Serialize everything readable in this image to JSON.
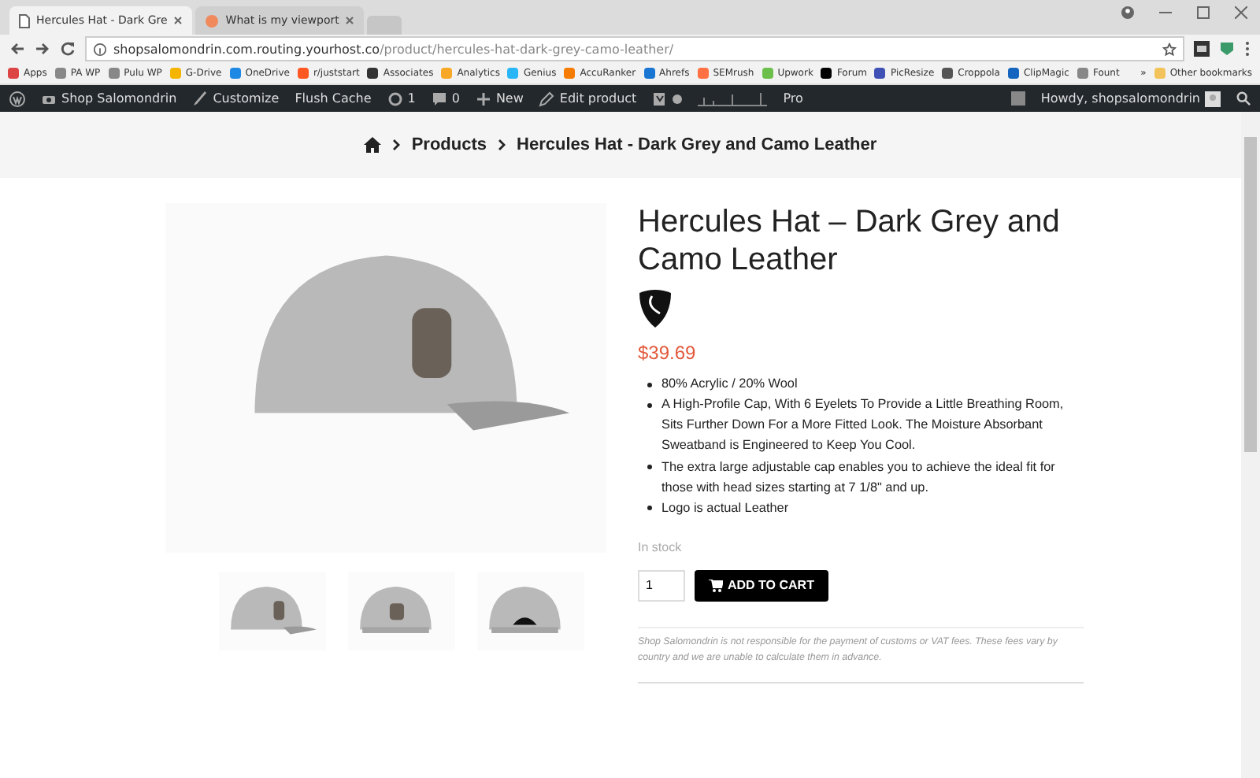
{
  "browser": {
    "tabs": [
      {
        "title": "Hercules Hat - Dark Gre",
        "selected": true
      },
      {
        "title": "What is my viewport",
        "selected": false
      }
    ],
    "url": {
      "host": "shopsalomondrin.com.routing.yourhost.co",
      "path": "/product/hercules-hat-dark-grey-camo-leather/"
    },
    "bookmarks": [
      "Apps",
      "PA WP",
      "Pulu WP",
      "G-Drive",
      "OneDrive",
      "r/juststart",
      "Associates",
      "Analytics",
      "Genius",
      "AccuRanker",
      "Ahrefs",
      "SEMrush",
      "Upwork",
      "Forum",
      "PicResize",
      "Croppola",
      "ClipMagic",
      "Fount"
    ],
    "overflow": "»",
    "other_bookmarks": "Other bookmarks"
  },
  "admin_bar": {
    "items": [
      {
        "kind": "logo"
      },
      {
        "kind": "site",
        "label": "Shop Salomondrin"
      },
      {
        "kind": "brush",
        "label": "Customize"
      },
      {
        "kind": "plain",
        "label": "Flush Cache"
      },
      {
        "kind": "updates",
        "label": "1"
      },
      {
        "kind": "comments",
        "label": "0"
      },
      {
        "kind": "plus",
        "label": "New"
      },
      {
        "kind": "pencil",
        "label": "Edit product"
      },
      {
        "kind": "seo"
      },
      {
        "kind": "plain",
        "label": "Pro"
      }
    ],
    "greeting": "Howdy, shopsalomondrin"
  },
  "breadcrumb": [
    "Products",
    "Hercules Hat - Dark Grey and Camo Leather"
  ],
  "product": {
    "title": "Hercules Hat – Dark Grey and Camo Leather",
    "price": "$39.69",
    "features": [
      "80% Acrylic / 20% Wool",
      "A High-Profile Cap, With 6 Eyelets To Provide a Little Breathing Room, Sits Further Down For a More Fitted Look. The Moisture Absorbant Sweatband is Engineered to Keep You Cool.",
      "The extra large adjustable cap enables you to achieve the ideal fit for those with head sizes starting at 7 1/8\" and up.",
      "Logo is actual Leather"
    ],
    "stock": "In stock",
    "quantity": "1",
    "add_to_cart": "ADD TO CART",
    "notice": "Shop Salomondrin is not responsible for the payment of customs or VAT fees. These fees vary by country and we are unable to calculate them in advance.",
    "thumbnails": [
      {
        "kind": "side"
      },
      {
        "kind": "front"
      },
      {
        "kind": "back"
      }
    ]
  }
}
